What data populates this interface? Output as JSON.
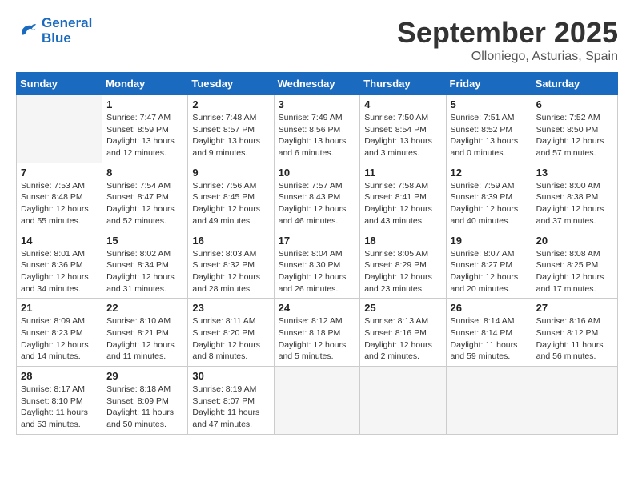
{
  "logo": {
    "line1": "General",
    "line2": "Blue"
  },
  "title": "September 2025",
  "location": "Olloniego, Asturias, Spain",
  "weekdays": [
    "Sunday",
    "Monday",
    "Tuesday",
    "Wednesday",
    "Thursday",
    "Friday",
    "Saturday"
  ],
  "weeks": [
    [
      {
        "day": "",
        "info": ""
      },
      {
        "day": "1",
        "info": "Sunrise: 7:47 AM\nSunset: 8:59 PM\nDaylight: 13 hours\nand 12 minutes."
      },
      {
        "day": "2",
        "info": "Sunrise: 7:48 AM\nSunset: 8:57 PM\nDaylight: 13 hours\nand 9 minutes."
      },
      {
        "day": "3",
        "info": "Sunrise: 7:49 AM\nSunset: 8:56 PM\nDaylight: 13 hours\nand 6 minutes."
      },
      {
        "day": "4",
        "info": "Sunrise: 7:50 AM\nSunset: 8:54 PM\nDaylight: 13 hours\nand 3 minutes."
      },
      {
        "day": "5",
        "info": "Sunrise: 7:51 AM\nSunset: 8:52 PM\nDaylight: 13 hours\nand 0 minutes."
      },
      {
        "day": "6",
        "info": "Sunrise: 7:52 AM\nSunset: 8:50 PM\nDaylight: 12 hours\nand 57 minutes."
      }
    ],
    [
      {
        "day": "7",
        "info": "Sunrise: 7:53 AM\nSunset: 8:48 PM\nDaylight: 12 hours\nand 55 minutes."
      },
      {
        "day": "8",
        "info": "Sunrise: 7:54 AM\nSunset: 8:47 PM\nDaylight: 12 hours\nand 52 minutes."
      },
      {
        "day": "9",
        "info": "Sunrise: 7:56 AM\nSunset: 8:45 PM\nDaylight: 12 hours\nand 49 minutes."
      },
      {
        "day": "10",
        "info": "Sunrise: 7:57 AM\nSunset: 8:43 PM\nDaylight: 12 hours\nand 46 minutes."
      },
      {
        "day": "11",
        "info": "Sunrise: 7:58 AM\nSunset: 8:41 PM\nDaylight: 12 hours\nand 43 minutes."
      },
      {
        "day": "12",
        "info": "Sunrise: 7:59 AM\nSunset: 8:39 PM\nDaylight: 12 hours\nand 40 minutes."
      },
      {
        "day": "13",
        "info": "Sunrise: 8:00 AM\nSunset: 8:38 PM\nDaylight: 12 hours\nand 37 minutes."
      }
    ],
    [
      {
        "day": "14",
        "info": "Sunrise: 8:01 AM\nSunset: 8:36 PM\nDaylight: 12 hours\nand 34 minutes."
      },
      {
        "day": "15",
        "info": "Sunrise: 8:02 AM\nSunset: 8:34 PM\nDaylight: 12 hours\nand 31 minutes."
      },
      {
        "day": "16",
        "info": "Sunrise: 8:03 AM\nSunset: 8:32 PM\nDaylight: 12 hours\nand 28 minutes."
      },
      {
        "day": "17",
        "info": "Sunrise: 8:04 AM\nSunset: 8:30 PM\nDaylight: 12 hours\nand 26 minutes."
      },
      {
        "day": "18",
        "info": "Sunrise: 8:05 AM\nSunset: 8:29 PM\nDaylight: 12 hours\nand 23 minutes."
      },
      {
        "day": "19",
        "info": "Sunrise: 8:07 AM\nSunset: 8:27 PM\nDaylight: 12 hours\nand 20 minutes."
      },
      {
        "day": "20",
        "info": "Sunrise: 8:08 AM\nSunset: 8:25 PM\nDaylight: 12 hours\nand 17 minutes."
      }
    ],
    [
      {
        "day": "21",
        "info": "Sunrise: 8:09 AM\nSunset: 8:23 PM\nDaylight: 12 hours\nand 14 minutes."
      },
      {
        "day": "22",
        "info": "Sunrise: 8:10 AM\nSunset: 8:21 PM\nDaylight: 12 hours\nand 11 minutes."
      },
      {
        "day": "23",
        "info": "Sunrise: 8:11 AM\nSunset: 8:20 PM\nDaylight: 12 hours\nand 8 minutes."
      },
      {
        "day": "24",
        "info": "Sunrise: 8:12 AM\nSunset: 8:18 PM\nDaylight: 12 hours\nand 5 minutes."
      },
      {
        "day": "25",
        "info": "Sunrise: 8:13 AM\nSunset: 8:16 PM\nDaylight: 12 hours\nand 2 minutes."
      },
      {
        "day": "26",
        "info": "Sunrise: 8:14 AM\nSunset: 8:14 PM\nDaylight: 11 hours\nand 59 minutes."
      },
      {
        "day": "27",
        "info": "Sunrise: 8:16 AM\nSunset: 8:12 PM\nDaylight: 11 hours\nand 56 minutes."
      }
    ],
    [
      {
        "day": "28",
        "info": "Sunrise: 8:17 AM\nSunset: 8:10 PM\nDaylight: 11 hours\nand 53 minutes."
      },
      {
        "day": "29",
        "info": "Sunrise: 8:18 AM\nSunset: 8:09 PM\nDaylight: 11 hours\nand 50 minutes."
      },
      {
        "day": "30",
        "info": "Sunrise: 8:19 AM\nSunset: 8:07 PM\nDaylight: 11 hours\nand 47 minutes."
      },
      {
        "day": "",
        "info": ""
      },
      {
        "day": "",
        "info": ""
      },
      {
        "day": "",
        "info": ""
      },
      {
        "day": "",
        "info": ""
      }
    ]
  ]
}
